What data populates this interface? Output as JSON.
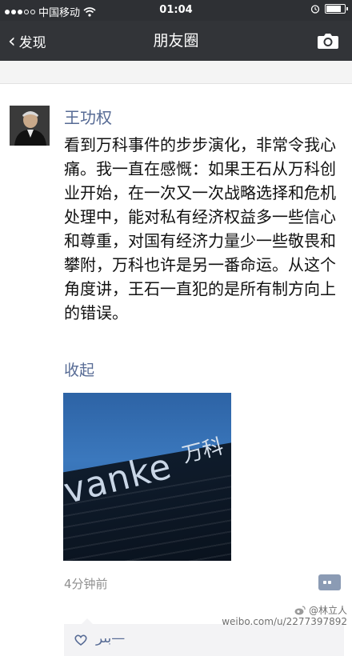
{
  "status_bar": {
    "carrier": "中国移动",
    "time": "01:04"
  },
  "nav": {
    "back_label": "发现",
    "title": "朋友圈"
  },
  "post": {
    "author": "王功权",
    "text": "看到万科事件的步步演化，非常令我心痛。我一直在感慨：如果王石从万科创业开始，在一次又一次战略选择和危机处理中，能对私有经济权益多一些信心和尊重，对国有经济力量少一些敬畏和攀附，万科也许是另一番命运。从这个角度讲，王石一直犯的是所有制方向上的错误。",
    "collapse_label": "收起",
    "image_logo_latin": "vanke",
    "image_logo_cn": "万科",
    "timestamp": "4分钟前",
    "likers": "بىر—"
  },
  "watermark": {
    "handle": "@林立人",
    "url": "weibo.com/u/2277397892"
  },
  "colors": {
    "nav_bg": "#323438",
    "link": "#576b95",
    "meta": "#8f8f8f"
  }
}
